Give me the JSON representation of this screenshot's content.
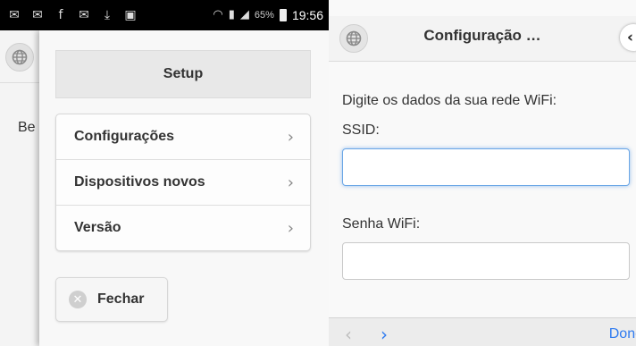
{
  "status_bar": {
    "icons": [
      "sms-icon",
      "sms-icon",
      "facebook-icon",
      "email-icon",
      "download-icon",
      "clipboard-icon"
    ],
    "battery": "65%",
    "time": "19:56"
  },
  "left": {
    "underlay_text": "Be",
    "panel": {
      "title": "Setup",
      "items": [
        {
          "label": "Configurações"
        },
        {
          "label": "Dispositivos novos"
        },
        {
          "label": "Versão"
        }
      ],
      "close_label": "Fechar"
    }
  },
  "right": {
    "title": "Configuração …",
    "intro": "Digite os dados da sua rede WiFi:",
    "ssid_label": "SSID:",
    "ssid_value": "",
    "password_label": "Senha WiFi:",
    "password_value": "",
    "toolbar": {
      "done_label": "Done"
    }
  },
  "colors": {
    "accent": "#2f7bf0",
    "focus": "#6aa6e6"
  }
}
